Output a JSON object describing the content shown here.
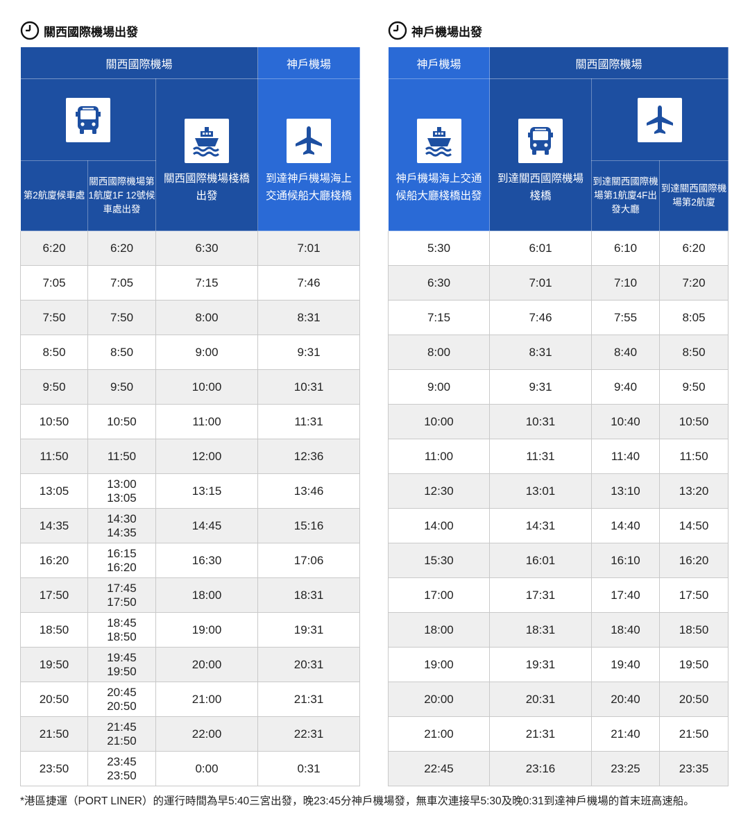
{
  "left": {
    "title": "關西國際機場出發",
    "group_header_1": "關西國際機場",
    "group_header_2": "神戶機場",
    "col_ferry_label": "關西國際機場棧橋出發",
    "col_arrival_label": "到達神戶機場海上交通候船大廳棧橋",
    "sub_1": "第2航廈候車處",
    "sub_2": "關西國際機場第1航廈1F 12號候車處出發",
    "icons": {
      "bus": "bus-icon",
      "ship": "ship-icon",
      "plane": "airplane-icon"
    },
    "rows": [
      {
        "c1": "6:20",
        "c2": [
          "6:20"
        ],
        "c3": "6:30",
        "c4": "7:01"
      },
      {
        "c1": "7:05",
        "c2": [
          "7:05"
        ],
        "c3": "7:15",
        "c4": "7:46"
      },
      {
        "c1": "7:50",
        "c2": [
          "7:50"
        ],
        "c3": "8:00",
        "c4": "8:31"
      },
      {
        "c1": "8:50",
        "c2": [
          "8:50"
        ],
        "c3": "9:00",
        "c4": "9:31"
      },
      {
        "c1": "9:50",
        "c2": [
          "9:50"
        ],
        "c3": "10:00",
        "c4": "10:31"
      },
      {
        "c1": "10:50",
        "c2": [
          "10:50"
        ],
        "c3": "11:00",
        "c4": "11:31"
      },
      {
        "c1": "11:50",
        "c2": [
          "11:50"
        ],
        "c3": "12:00",
        "c4": "12:36"
      },
      {
        "c1": "13:05",
        "c2": [
          "13:00",
          "13:05"
        ],
        "c3": "13:15",
        "c4": "13:46"
      },
      {
        "c1": "14:35",
        "c2": [
          "14:30",
          "14:35"
        ],
        "c3": "14:45",
        "c4": "15:16"
      },
      {
        "c1": "16:20",
        "c2": [
          "16:15",
          "16:20"
        ],
        "c3": "16:30",
        "c4": "17:06"
      },
      {
        "c1": "17:50",
        "c2": [
          "17:45",
          "17:50"
        ],
        "c3": "18:00",
        "c4": "18:31"
      },
      {
        "c1": "18:50",
        "c2": [
          "18:45",
          "18:50"
        ],
        "c3": "19:00",
        "c4": "19:31"
      },
      {
        "c1": "19:50",
        "c2": [
          "19:45",
          "19:50"
        ],
        "c3": "20:00",
        "c4": "20:31"
      },
      {
        "c1": "20:50",
        "c2": [
          "20:45",
          "20:50"
        ],
        "c3": "21:00",
        "c4": "21:31"
      },
      {
        "c1": "21:50",
        "c2": [
          "21:45",
          "21:50"
        ],
        "c3": "22:00",
        "c4": "22:31"
      },
      {
        "c1": "23:50",
        "c2": [
          "23:45",
          "23:50"
        ],
        "c3": "0:00",
        "c4": "0:31"
      }
    ]
  },
  "right": {
    "title": "神戶機場出發",
    "group_header_1": "神戶機場",
    "group_header_2": "關西國際機場",
    "col_ferry_label": "神戶機場海上交通候船大廳棧橋出發",
    "col_arrival_label": "到達關西國際機場棧橋",
    "sub_1": "到達關西國際機場第1航廈4F出發大廳",
    "sub_2": "到達關西國際機場第2航廈",
    "rows": [
      [
        "5:30",
        "6:01",
        "6:10",
        "6:20"
      ],
      [
        "6:30",
        "7:01",
        "7:10",
        "7:20"
      ],
      [
        "7:15",
        "7:46",
        "7:55",
        "8:05"
      ],
      [
        "8:00",
        "8:31",
        "8:40",
        "8:50"
      ],
      [
        "9:00",
        "9:31",
        "9:40",
        "9:50"
      ],
      [
        "10:00",
        "10:31",
        "10:40",
        "10:50"
      ],
      [
        "11:00",
        "11:31",
        "11:40",
        "11:50"
      ],
      [
        "12:30",
        "13:01",
        "13:10",
        "13:20"
      ],
      [
        "14:00",
        "14:31",
        "14:40",
        "14:50"
      ],
      [
        "15:30",
        "16:01",
        "16:10",
        "16:20"
      ],
      [
        "17:00",
        "17:31",
        "17:40",
        "17:50"
      ],
      [
        "18:00",
        "18:31",
        "18:40",
        "18:50"
      ],
      [
        "19:00",
        "19:31",
        "19:40",
        "19:50"
      ],
      [
        "20:00",
        "20:31",
        "20:40",
        "20:50"
      ],
      [
        "21:00",
        "21:31",
        "21:40",
        "21:50"
      ],
      [
        "22:45",
        "23:16",
        "23:25",
        "23:35"
      ]
    ]
  },
  "footnote": "*港區捷運（PORT LINER）的運行時間為早5:40三宮出發，晚23:45分神戶機場發，無車次連接早5:30及晚0:31到達神戶機場的首末班高速船。",
  "colors": {
    "dark_blue": "#1d4fa1",
    "light_blue": "#2a6ad6",
    "row_gray": "#efefef"
  }
}
